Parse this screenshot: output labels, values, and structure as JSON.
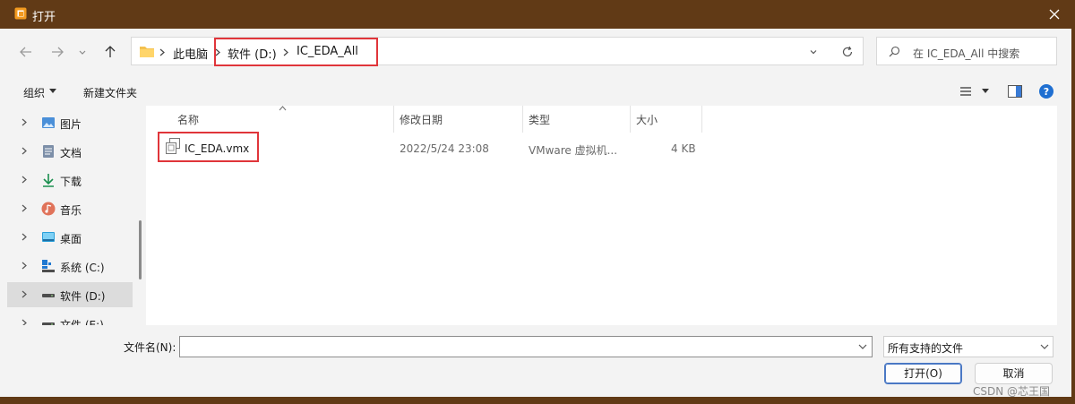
{
  "window": {
    "title": "打开",
    "accent": "#613a16"
  },
  "nav": {
    "breadcrumb": [
      "此电脑",
      "软件 (D:)",
      "IC_EDA_All"
    ],
    "search_placeholder": "在 IC_EDA_All 中搜索"
  },
  "toolbar": {
    "organize": "组织",
    "new_folder": "新建文件夹"
  },
  "sidebar": {
    "items": [
      {
        "label": "图片",
        "icon": "pictures-icon"
      },
      {
        "label": "文档",
        "icon": "documents-icon"
      },
      {
        "label": "下载",
        "icon": "download-icon"
      },
      {
        "label": "音乐",
        "icon": "music-icon"
      },
      {
        "label": "桌面",
        "icon": "desktop-icon"
      },
      {
        "label": "系统 (C:)",
        "icon": "system-drive-icon"
      },
      {
        "label": "软件 (D:)",
        "icon": "drive-icon"
      },
      {
        "label": "文件 (E:)",
        "icon": "drive-icon"
      }
    ]
  },
  "filelist": {
    "columns": [
      "名称",
      "修改日期",
      "类型",
      "大小"
    ],
    "rows": [
      {
        "name": "IC_EDA.vmx",
        "modified": "2022/5/24 23:08",
        "type": "VMware 虚拟机...",
        "size": "4 KB"
      }
    ]
  },
  "footer": {
    "filename_label": "文件名(N):",
    "filename_value": "",
    "filetype_value": "所有支持的文件",
    "open_label": "打开(O)",
    "cancel_label": "取消"
  },
  "watermark": "CSDN @芯王国"
}
